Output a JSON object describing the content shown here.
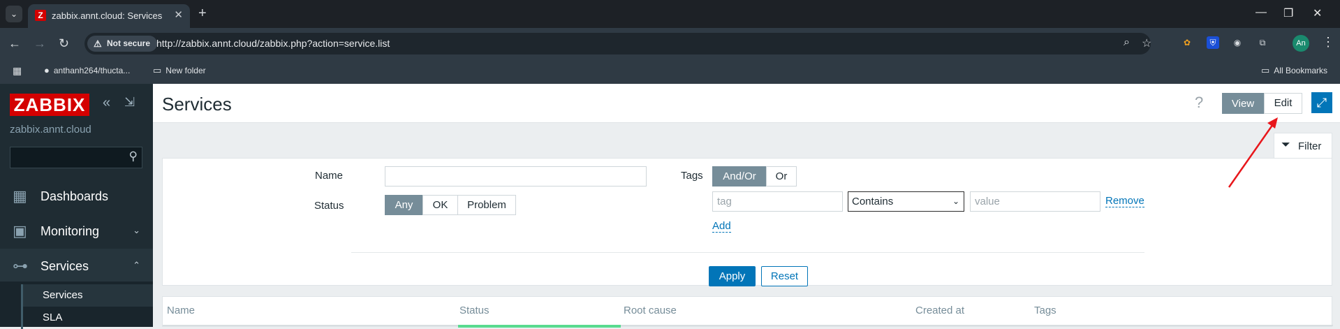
{
  "browser": {
    "tab_title": "zabbix.annt.cloud: Services",
    "tab_favicon": "Z",
    "tab_close": "✕",
    "new_tab": "+",
    "security_chip": "Not secure",
    "url": "http://zabbix.annt.cloud/zabbix.php?action=service.list",
    "avatar": "An",
    "bookmarks": [
      {
        "label": "anthanh264/thucta...",
        "icon": "github-icon"
      },
      {
        "label": "New folder",
        "icon": "folder-icon"
      }
    ],
    "all_bookmarks": "All Bookmarks"
  },
  "sidebar": {
    "logo": "ZABBIX",
    "host": "zabbix.annt.cloud",
    "search_value": "",
    "menu": [
      {
        "label": "Dashboards",
        "icon": "dashboards-icon"
      },
      {
        "label": "Monitoring",
        "icon": "monitoring-icon"
      },
      {
        "label": "Services",
        "icon": "services-icon"
      }
    ],
    "submenu": [
      "Services",
      "SLA"
    ]
  },
  "header": {
    "title": "Services",
    "help": "?",
    "view_label": "View",
    "edit_label": "Edit"
  },
  "filter": {
    "tab_label": "Filter",
    "name_label": "Name",
    "name_value": "",
    "status_label": "Status",
    "status_options": [
      "Any",
      "OK",
      "Problem"
    ],
    "status_selected": "Any",
    "tags_label": "Tags",
    "tags_mode_options": [
      "And/Or",
      "Or"
    ],
    "tags_mode_selected": "And/Or",
    "tag_placeholder": "tag",
    "operator_value": "Contains",
    "value_placeholder": "value",
    "remove_label": "Remove",
    "add_label": "Add",
    "apply_label": "Apply",
    "reset_label": "Reset"
  },
  "table": {
    "columns": [
      "Name",
      "Status",
      "Root cause",
      "Created at",
      "Tags"
    ],
    "status_color": "#59db8f"
  },
  "colors": {
    "brand_red": "#d40000",
    "accent_blue": "#0275b8",
    "sidebar_bg": "#1f2c33",
    "annotation_arrow": "#e8161b"
  }
}
